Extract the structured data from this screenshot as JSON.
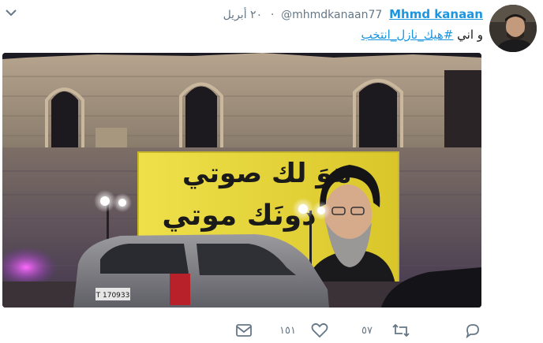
{
  "tweet": {
    "author_name": "Mhmd kanaan",
    "handle": "@mhmdkanaan77",
    "separator": "·",
    "date": "٢٠ أبريل",
    "text_prefix": "و اني ",
    "hashtag": "#هيك_نازل_انتخب"
  },
  "billboard": {
    "line1": "هوَ لك صوتي",
    "line2": "دونَك موتي"
  },
  "car": {
    "plate": "T 170933"
  },
  "actions": {
    "like_count": "١٥١",
    "retweet_count": "٥٧",
    "message_icon": "envelope-icon",
    "like_icon": "heart-icon",
    "retweet_icon": "retweet-icon",
    "reply_icon": "reply-icon"
  },
  "colors": {
    "link": "#1b95e0",
    "muted": "#657786",
    "billboard_yellow": "#f2e23a"
  }
}
